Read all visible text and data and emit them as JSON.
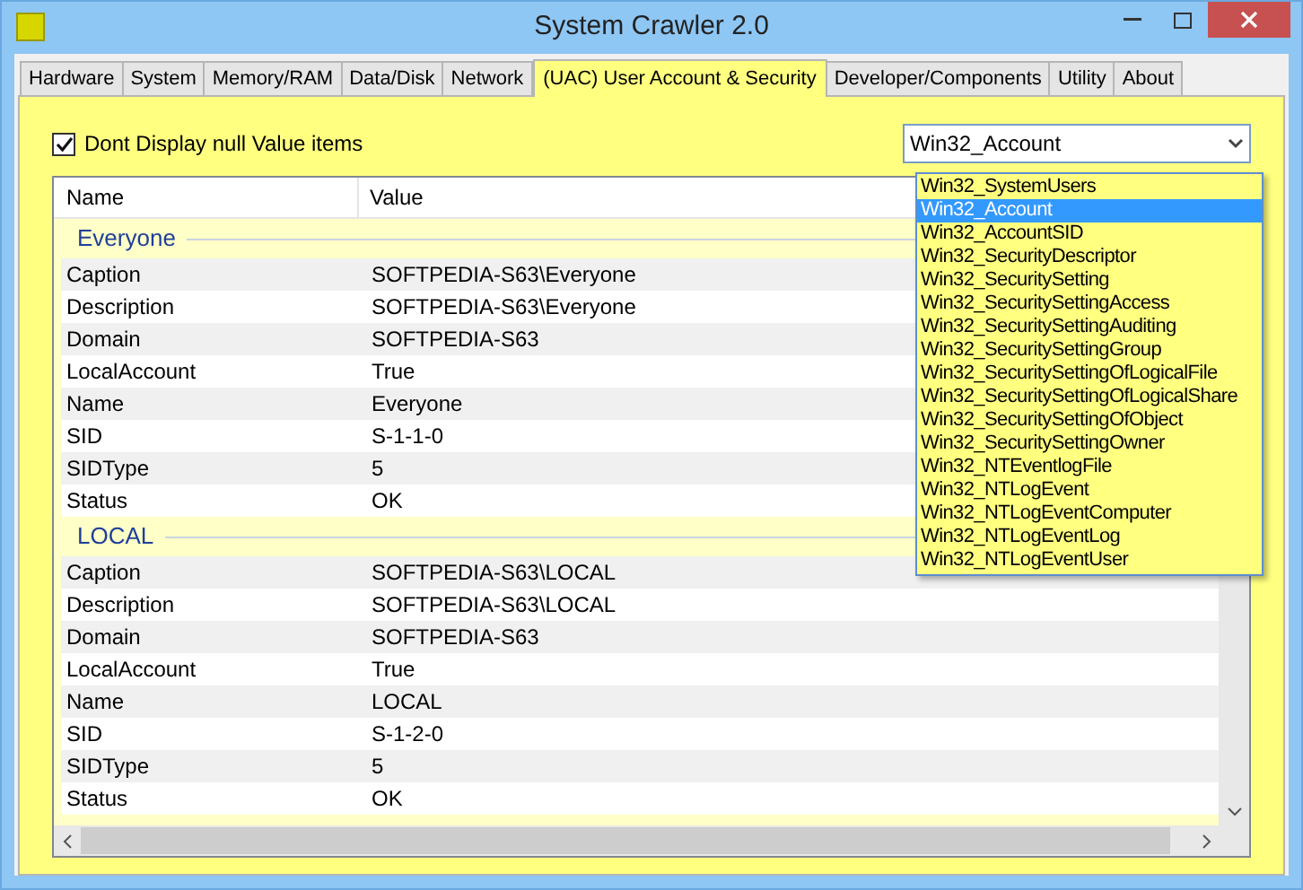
{
  "window": {
    "title": "System Crawler 2.0"
  },
  "tabs": [
    {
      "label": "Hardware",
      "selected": false
    },
    {
      "label": "System",
      "selected": false
    },
    {
      "label": "Memory/RAM",
      "selected": false
    },
    {
      "label": "Data/Disk",
      "selected": false
    },
    {
      "label": "Network",
      "selected": false
    },
    {
      "label": "(UAC) User Account & Security",
      "selected": true
    },
    {
      "label": "Developer/Components",
      "selected": false
    },
    {
      "label": "Utility",
      "selected": false
    },
    {
      "label": "About",
      "selected": false
    }
  ],
  "null_filter": {
    "label": "Dont Display null Value items",
    "checked": true
  },
  "class_select": {
    "value": "Win32_Account",
    "expanded": true,
    "options": [
      {
        "label": "Win32_SystemUsers",
        "selected": false
      },
      {
        "label": "Win32_Account",
        "selected": true
      },
      {
        "label": "Win32_AccountSID",
        "selected": false
      },
      {
        "label": "Win32_SecurityDescriptor",
        "selected": false
      },
      {
        "label": "Win32_SecuritySetting",
        "selected": false
      },
      {
        "label": "Win32_SecuritySettingAccess",
        "selected": false
      },
      {
        "label": "Win32_SecuritySettingAuditing",
        "selected": false
      },
      {
        "label": "Win32_SecuritySettingGroup",
        "selected": false
      },
      {
        "label": "Win32_SecuritySettingOfLogicalFile",
        "selected": false
      },
      {
        "label": "Win32_SecuritySettingOfLogicalShare",
        "selected": false
      },
      {
        "label": "Win32_SecuritySettingOfObject",
        "selected": false
      },
      {
        "label": "Win32_SecuritySettingOwner",
        "selected": false
      },
      {
        "label": "Win32_NTEventlogFile",
        "selected": false
      },
      {
        "label": "Win32_NTLogEvent",
        "selected": false
      },
      {
        "label": "Win32_NTLogEventComputer",
        "selected": false
      },
      {
        "label": "Win32_NTLogEventLog",
        "selected": false
      },
      {
        "label": "Win32_NTLogEventUser",
        "selected": false
      }
    ]
  },
  "table": {
    "columns": [
      "Name",
      "Value"
    ],
    "groups": [
      {
        "title": "Everyone",
        "rows": [
          [
            "Caption",
            "SOFTPEDIA-S63\\Everyone"
          ],
          [
            "Description",
            "SOFTPEDIA-S63\\Everyone"
          ],
          [
            "Domain",
            "SOFTPEDIA-S63"
          ],
          [
            "LocalAccount",
            "True"
          ],
          [
            "Name",
            "Everyone"
          ],
          [
            "SID",
            "S-1-1-0"
          ],
          [
            "SIDType",
            "5"
          ],
          [
            "Status",
            "OK"
          ]
        ]
      },
      {
        "title": "LOCAL",
        "rows": [
          [
            "Caption",
            "SOFTPEDIA-S63\\LOCAL"
          ],
          [
            "Description",
            "SOFTPEDIA-S63\\LOCAL"
          ],
          [
            "Domain",
            "SOFTPEDIA-S63"
          ],
          [
            "LocalAccount",
            "True"
          ],
          [
            "Name",
            "LOCAL"
          ],
          [
            "SID",
            "S-1-2-0"
          ],
          [
            "SIDType",
            "5"
          ],
          [
            "Status",
            "OK"
          ]
        ]
      }
    ]
  }
}
